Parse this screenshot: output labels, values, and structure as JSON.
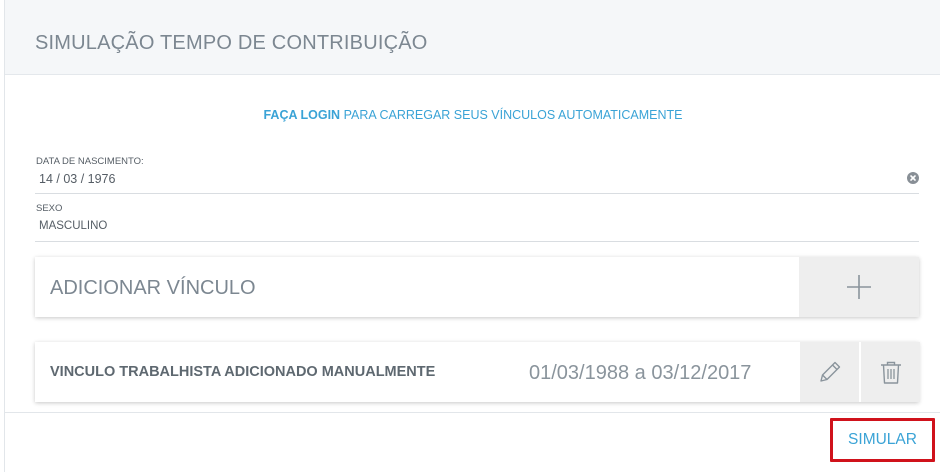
{
  "header": {
    "title": "SIMULAÇÃO TEMPO DE CONTRIBUIÇÃO"
  },
  "login_prompt": {
    "link_text": "FAÇA LOGIN",
    "rest_text": " PARA CARREGAR SEUS VÍNCULOS AUTOMATICAMENTE"
  },
  "form": {
    "birth_date": {
      "label": "DATA DE NASCIMENTO:",
      "value": "14 / 03 / 1976"
    },
    "sex": {
      "label": "SEXO",
      "value": "MASCULINO"
    }
  },
  "add_link": {
    "label": "ADICIONAR VÍNCULO",
    "icon": "plus-icon"
  },
  "links": [
    {
      "name": "VINCULO TRABALHISTA ADICIONADO MANUALMENTE",
      "period": "01/03/1988 a 03/12/2017",
      "edit_icon": "pencil-icon",
      "delete_icon": "trash-icon"
    }
  ],
  "actions": {
    "simulate_label": "SIMULAR"
  },
  "colors": {
    "accent": "#3aa3d6",
    "highlight_border": "#d0121b",
    "header_bg": "#f5f7f9"
  }
}
